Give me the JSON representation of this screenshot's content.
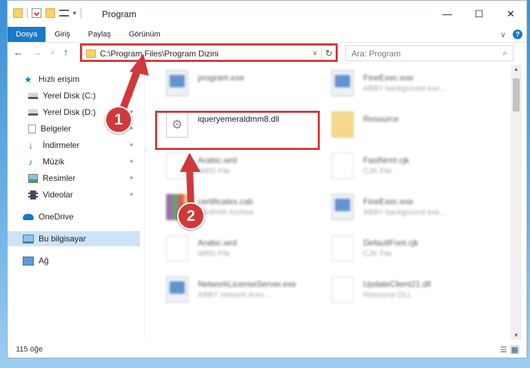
{
  "window": {
    "title": "Program"
  },
  "caption": {
    "minimize": "—",
    "maximize": "☐",
    "close": "✕"
  },
  "ribbon": {
    "tabs": [
      "Dosya",
      "Giriş",
      "Paylaş",
      "Görünüm"
    ],
    "expand": "∨",
    "help": "?"
  },
  "nav": {
    "back": "←",
    "forward": "→",
    "history": "∨",
    "up": "↑"
  },
  "address": {
    "path": "C:\\Program Files\\Program Dizini",
    "dropdown": "∨",
    "refresh": "↻"
  },
  "search": {
    "placeholder": "Ara: Program",
    "icon": "search-icon"
  },
  "sidebar": {
    "items": [
      {
        "label": "Hızlı erişim",
        "icon": "star-icon",
        "color": "#1979ca"
      },
      {
        "label": "Yerel Disk (C:)",
        "icon": "disk-icon",
        "pinned": true
      },
      {
        "label": "Yerel Disk (D:)",
        "icon": "disk-icon",
        "pinned": true
      },
      {
        "label": "Belgeler",
        "icon": "documents-icon",
        "pinned": true
      },
      {
        "label": "İndirmeler",
        "icon": "download-icon",
        "pinned": true
      },
      {
        "label": "Müzik",
        "icon": "music-icon",
        "pinned": true
      },
      {
        "label": "Resimler",
        "icon": "pictures-icon",
        "pinned": true
      },
      {
        "label": "Videolar",
        "icon": "videos-icon",
        "pinned": true
      },
      {
        "label": "OneDrive",
        "icon": "cloud-icon"
      },
      {
        "label": "Bu bilgisayar",
        "icon": "computer-icon",
        "selected": true
      },
      {
        "label": "Ağ",
        "icon": "network-icon"
      }
    ],
    "pin_glyph": "📌"
  },
  "files": [
    {
      "name": "program.exe",
      "sub": "",
      "kind": "exe"
    },
    {
      "name": "FineExec.exe",
      "sub": "ABBY background exe...",
      "kind": "exe"
    },
    {
      "name": "iqueryemeraldmm8.dll",
      "sub": "",
      "kind": "dll"
    },
    {
      "name": "Resource",
      "sub": "",
      "kind": "folder"
    },
    {
      "name": "Arabic.wrd",
      "sub": "WRD File",
      "kind": "doc"
    },
    {
      "name": "FastNrml.cjk",
      "sub": "CJK File",
      "kind": "doc"
    },
    {
      "name": "certificates.cab",
      "sub": "WinRAR Archive",
      "kind": "rar"
    },
    {
      "name": "FineExec.exe",
      "sub": "ABBY background exe...",
      "kind": "exe"
    },
    {
      "name": "Arabic.wrd",
      "sub": "WRD File",
      "kind": "doc"
    },
    {
      "name": "DefaultFont.cjk",
      "sub": "CJK File",
      "kind": "doc"
    },
    {
      "name": "NetworkLicenseServer.exe",
      "sub": "ABBY network licen...",
      "kind": "exe"
    },
    {
      "name": "UpdateClient21.dll",
      "sub": "Resource DLL",
      "kind": "doc"
    }
  ],
  "status": {
    "count": "115 öğe"
  },
  "annotations": {
    "badge1": "1",
    "badge2": "2",
    "accent": "#d0393b"
  }
}
